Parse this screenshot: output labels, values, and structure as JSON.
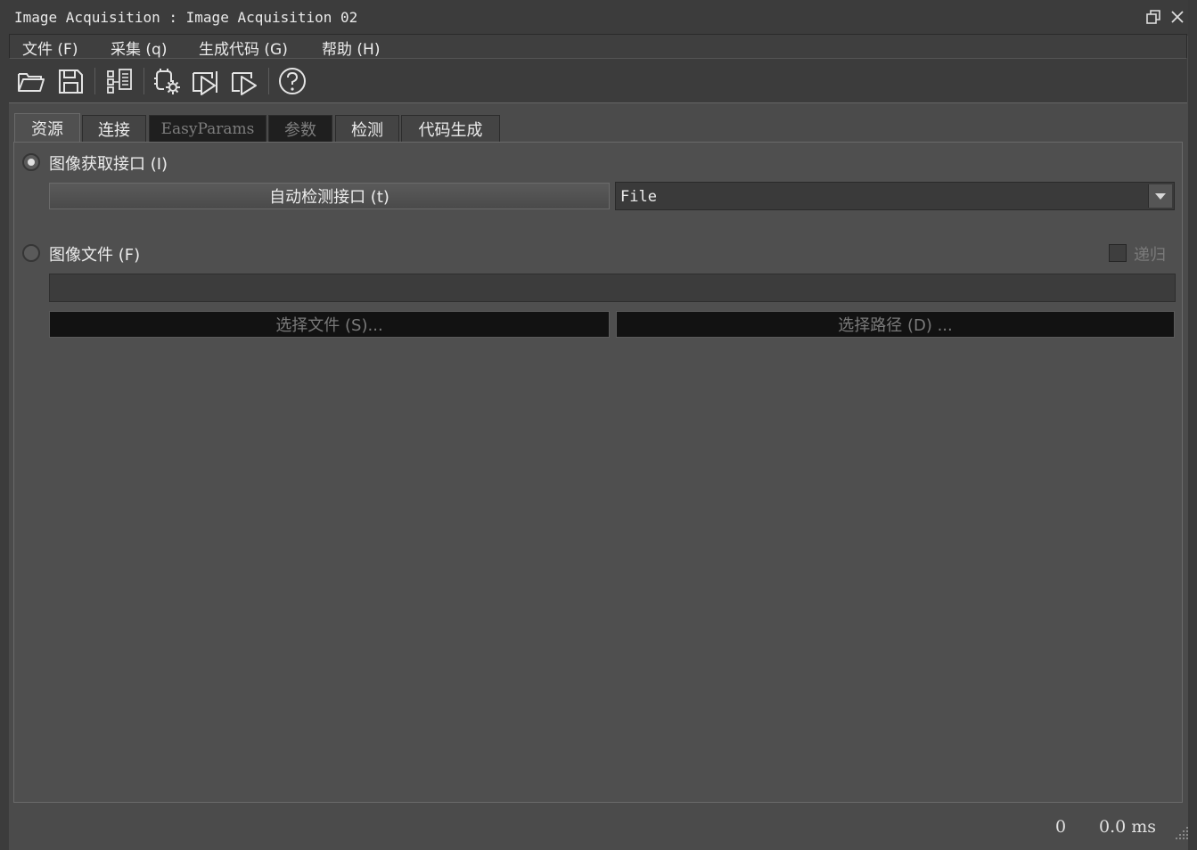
{
  "window": {
    "title": "Image Acquisition : Image Acquisition 02"
  },
  "menu": [
    {
      "label": "文件 (F)",
      "icon": "menu-file"
    },
    {
      "label": "采集 (q)",
      "icon": "menu-acquisition"
    },
    {
      "label": "生成代码 (G)",
      "icon": "menu-codegen"
    },
    {
      "label": "帮助 (H)",
      "icon": "menu-help"
    }
  ],
  "toolbar": {
    "icons": [
      "open-folder-icon",
      "save-icon",
      "detect-interfaces-icon",
      "connect-settings-icon",
      "snap-icon",
      "live-icon",
      "help-icon"
    ]
  },
  "tabs": [
    {
      "label": "资源",
      "state": "active"
    },
    {
      "label": "连接",
      "state": "normal"
    },
    {
      "label": "EasyParams",
      "state": "disabled"
    },
    {
      "label": "参数",
      "state": "disabled"
    },
    {
      "label": "检测",
      "state": "normal"
    },
    {
      "label": "代码生成",
      "state": "normal"
    }
  ],
  "source": {
    "interface_option": {
      "label": "图像获取接口 (I)",
      "selected": true
    },
    "auto_detect_label": "自动检测接口 (t)",
    "interface_value": "File",
    "file_option": {
      "label": "图像文件 (F)",
      "selected": false
    },
    "recursive_label": "递归",
    "path_value": "",
    "select_file_label": "选择文件 (S)...",
    "select_dir_label": "选择路径 (D) ..."
  },
  "status": {
    "frame_count": "0",
    "time": "0.0 ms"
  },
  "colors": {
    "background": "#4f4f4f",
    "titlebar": "#3c3c3c",
    "text": "#ececec",
    "disabled_text": "#7a7a7a"
  }
}
